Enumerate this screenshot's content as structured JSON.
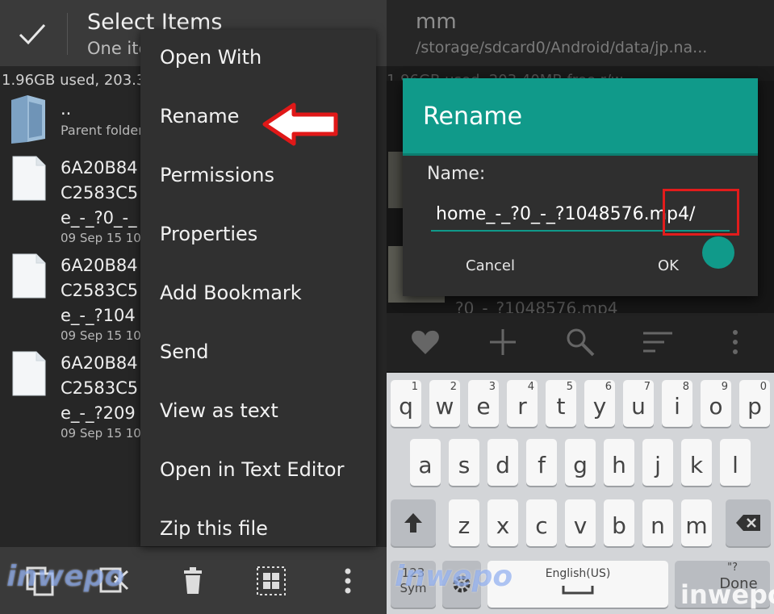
{
  "left": {
    "title": "Select Items",
    "subtitle": "One ite",
    "storage": "1.96GB used, 203.3",
    "parent": {
      "name": "..",
      "label": "Parent folder"
    },
    "files": [
      {
        "line1": "6A20B84",
        "line2": "C2583C5",
        "line3": "e_-_?0_-_",
        "date": "09 Sep 15 10"
      },
      {
        "line1": "6A20B84",
        "line2": "C2583C5",
        "line3": "e_-_?104",
        "date": "09 Sep 15 10"
      },
      {
        "line1": "6A20B84",
        "line2": "C2583C5",
        "line3": "e_-_?209",
        "date": "09 Sep 15 10"
      }
    ],
    "menu": [
      "Open With",
      "Rename",
      "Permissions",
      "Properties",
      "Add Bookmark",
      "Send",
      "View as text",
      "Open in Text Editor",
      "Zip this file"
    ],
    "watermark": "inwepo"
  },
  "right": {
    "title": "mm",
    "path": "/storage/sdcard0/Android/data/jp.na...",
    "storage": "1.96GB used, 203.40MB free r/w",
    "dim_name": "_?0_-_?1048576.mp4",
    "dialog": {
      "title": "Rename",
      "label": "Name:",
      "value": "/home_-_?0_-_?1048576.mp4",
      "cancel": "Cancel",
      "ok": "OK"
    },
    "keyboard": {
      "row1": [
        {
          "k": "q",
          "h": "1"
        },
        {
          "k": "w",
          "h": "2"
        },
        {
          "k": "e",
          "h": "3"
        },
        {
          "k": "r",
          "h": "4"
        },
        {
          "k": "t",
          "h": "5"
        },
        {
          "k": "y",
          "h": "6"
        },
        {
          "k": "u",
          "h": "7"
        },
        {
          "k": "i",
          "h": "8"
        },
        {
          "k": "o",
          "h": "9"
        },
        {
          "k": "p",
          "h": "0"
        }
      ],
      "row2": [
        "a",
        "s",
        "d",
        "f",
        "g",
        "h",
        "j",
        "k",
        "l"
      ],
      "row3": [
        "z",
        "x",
        "c",
        "v",
        "b",
        "n",
        "m"
      ],
      "sym": "123\nSym",
      "space": "English(US)",
      "done": "Done",
      "done_hint": "\"?"
    },
    "watermark": "inwepo"
  }
}
